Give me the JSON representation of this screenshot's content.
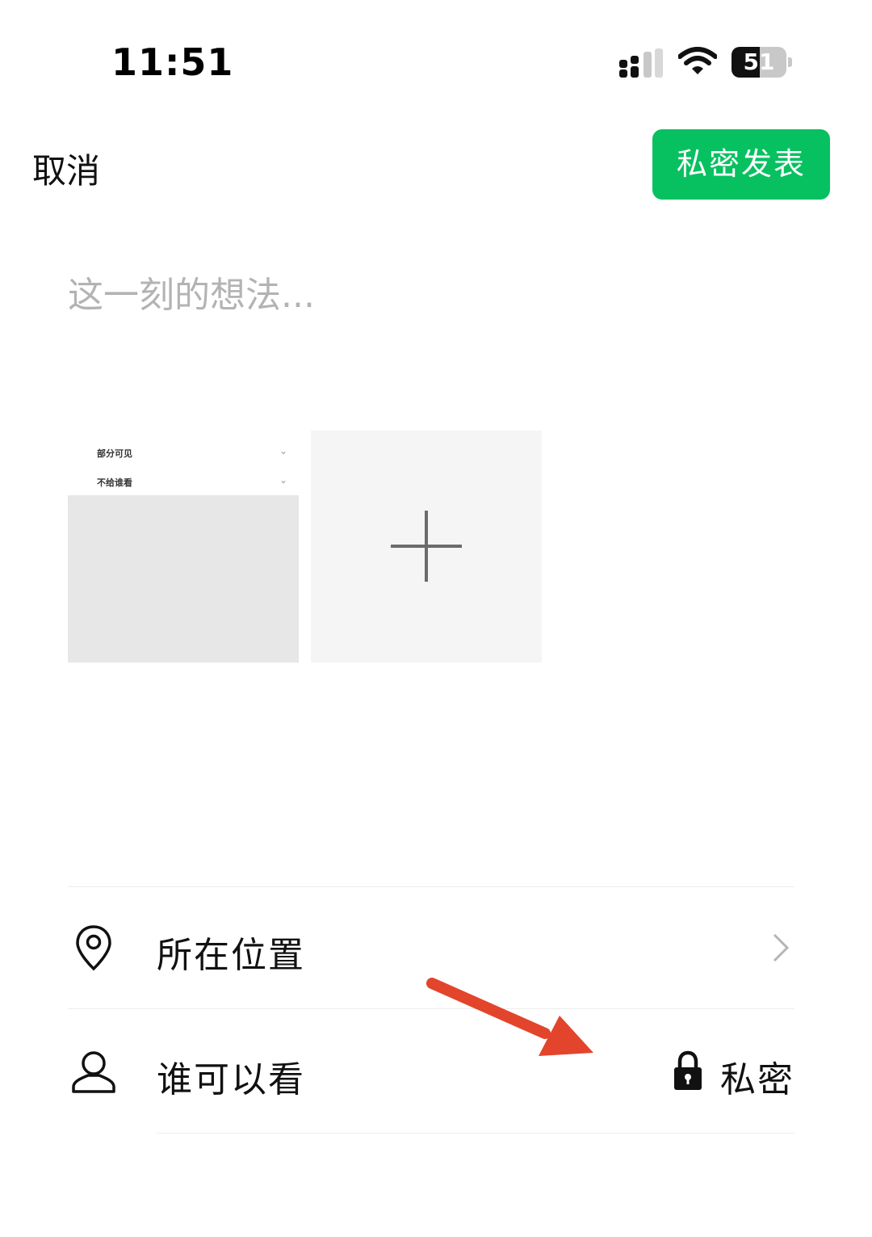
{
  "status_bar": {
    "time": "11:51",
    "battery_level": "51",
    "battery_fill_fraction": 0.51,
    "icons": [
      "signal-icon",
      "wifi-icon",
      "battery-icon"
    ]
  },
  "nav": {
    "cancel_label": "取消",
    "publish_label": "私密发表",
    "publish_color": "#07c160"
  },
  "composer": {
    "placeholder": "这一刻的想法...",
    "value": ""
  },
  "photos": {
    "thumbnail_rows": [
      "部分可见",
      "不给谁看"
    ],
    "add_icon": "plus-icon"
  },
  "options": {
    "location": {
      "label": "所在位置",
      "icon": "location-pin-icon"
    },
    "visibility": {
      "label": "谁可以看",
      "value": "私密",
      "icon": "user-icon",
      "value_icon": "lock-icon"
    }
  },
  "annotation": {
    "color": "#e2452b"
  }
}
